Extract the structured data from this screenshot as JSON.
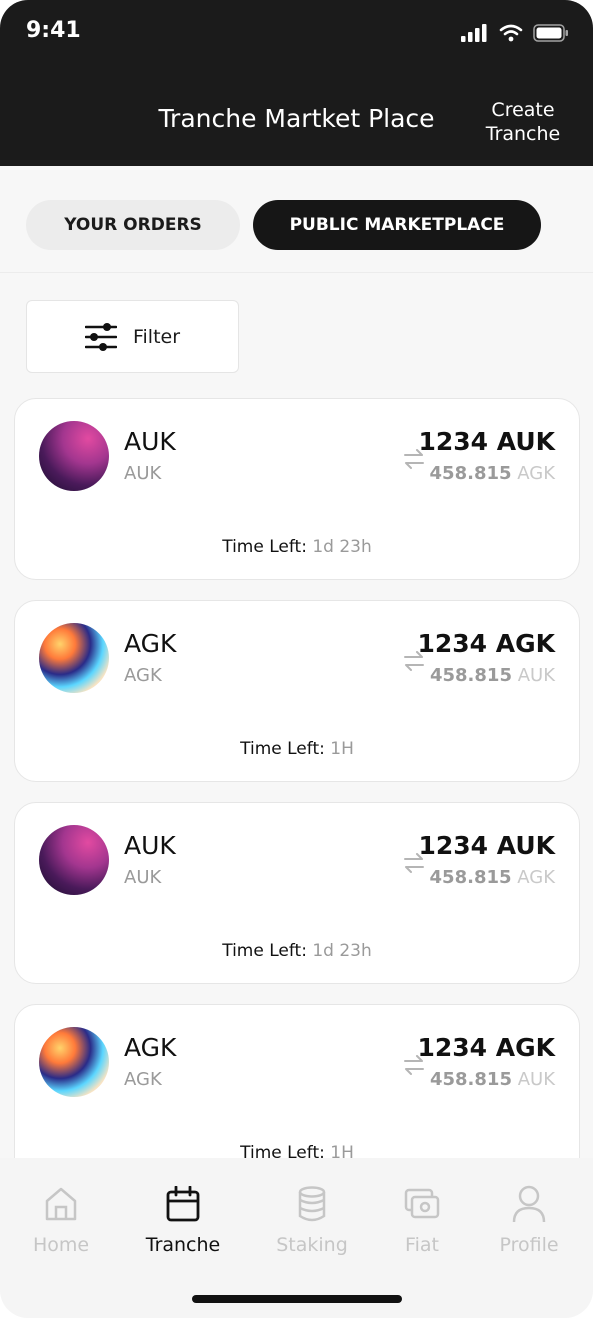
{
  "status_bar": {
    "time": "9:41"
  },
  "header": {
    "title": "Tranche Martket Place",
    "create_line1": "Create",
    "create_line2": "Tranche"
  },
  "tabs": [
    {
      "label": "YOUR ORDERS",
      "active": false
    },
    {
      "label": "PUBLIC MARKETPLACE",
      "active": true
    }
  ],
  "filter": {
    "label": "Filter"
  },
  "time_left_label": "Time Left:",
  "cards": [
    {
      "symbol": "AUK",
      "subtitle": "AUK",
      "amount": "1234 AUK",
      "conv_value": "458.815",
      "conv_currency": "AGK",
      "time_left": "1d 23h",
      "avatar": "auk-token-icon"
    },
    {
      "symbol": "AGK",
      "subtitle": "AGK",
      "amount": "1234 AGK",
      "conv_value": "458.815",
      "conv_currency": "AUK",
      "time_left": "1H",
      "avatar": "agk-token-icon"
    },
    {
      "symbol": "AUK",
      "subtitle": "AUK",
      "amount": "1234 AUK",
      "conv_value": "458.815",
      "conv_currency": "AGK",
      "time_left": "1d 23h",
      "avatar": "auk-token-icon"
    },
    {
      "symbol": "AGK",
      "subtitle": "AGK",
      "amount": "1234 AGK",
      "conv_value": "458.815",
      "conv_currency": "AUK",
      "time_left": "1H",
      "avatar": "agk-token-icon"
    }
  ],
  "nav": [
    {
      "label": "Home",
      "icon": "home-icon",
      "active": false
    },
    {
      "label": "Tranche",
      "icon": "calendar-icon",
      "active": true
    },
    {
      "label": "Staking",
      "icon": "coins-stack-icon",
      "active": false
    },
    {
      "label": "Fiat",
      "icon": "cash-icon",
      "active": false
    },
    {
      "label": "Profile",
      "icon": "user-icon",
      "active": false
    }
  ]
}
